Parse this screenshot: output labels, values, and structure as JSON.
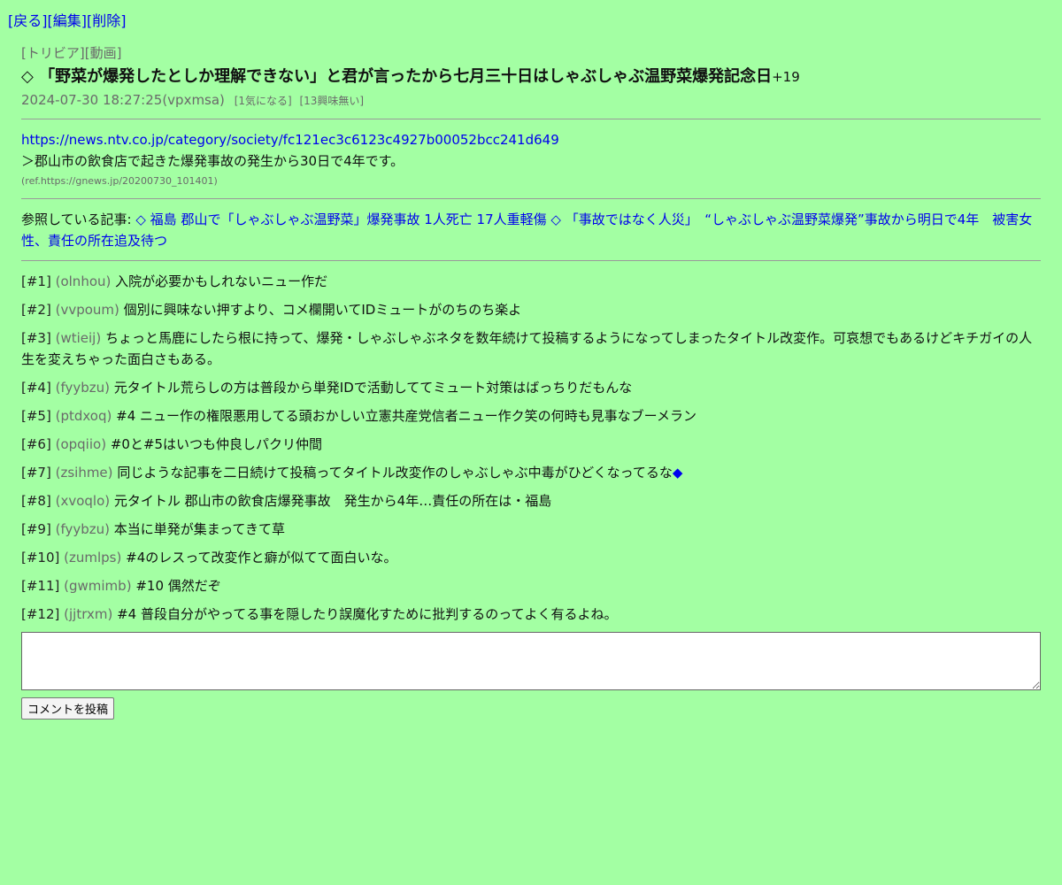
{
  "nav": {
    "back": "[戻る]",
    "edit": "[編集]",
    "delete": "[削除]"
  },
  "article": {
    "cat1": "[トリビア]",
    "cat2": "[動画]",
    "title": "◇ 「野菜が爆発したとしか理解できない」と君が言ったから七月三十日はしゃぶしゃぶ温野菜爆発記念日",
    "score": "+19",
    "date": "2024-07-30 18:27:25",
    "author": "(vpxmsa)",
    "interested": "[1気になる]",
    "not_interested": "[13興味無い]",
    "url": "https://news.ntv.co.jp/category/society/fc121ec3c6123c4927b00052bcc241d649",
    "quote": "＞郡山市の飲食店で起きた爆発事故の発生から30日で4年です。",
    "ref": "(ref.https://gnews.jp/20200730_101401)",
    "related_label": "参照している記事: ",
    "related_link1": "◇ 福島 郡山で「しゃぶしゃぶ温野菜」爆発事故 1人死亡 17人重軽傷",
    "related_link2": "◇ 「事故ではなく人災」　“しゃぶしゃぶ温野菜爆発”事故から明日で4年　被害女性、責任の所在追及待つ"
  },
  "comments": [
    {
      "num": "[#1]",
      "uid": "(olnhou)",
      "text": "入院が必要かもしれないニュー作だ"
    },
    {
      "num": "[#2]",
      "uid": "(vvpoum)",
      "text": "個別に興味ない押すより、コメ欄開いてIDミュートがのちのち楽よ"
    },
    {
      "num": "[#3]",
      "uid": "(wtieij)",
      "text": "ちょっと馬鹿にしたら根に持って、爆発・しゃぶしゃぶネタを数年続けて投稿するようになってしまったタイトル改変作。可哀想でもあるけどキチガイの人生を変えちゃった面白さもある。"
    },
    {
      "num": "[#4]",
      "uid": "(fyybzu)",
      "text": "元タイトル荒らしの方は普段から単発IDで活動しててミュート対策はばっちりだもんな"
    },
    {
      "num": "[#5]",
      "uid": "(ptdxoq)",
      "text": "#4 ニュー作の権限悪用してる頭おかしい立憲共産党信者ニュー作ク笑の何時も見事なブーメラン"
    },
    {
      "num": "[#6]",
      "uid": "(opqiio)",
      "text": "#0と#5はいつも仲良しパクリ仲間"
    },
    {
      "num": "[#7]",
      "uid": "(zsihme)",
      "text": "同じような記事を二日続けて投稿ってタイトル改変作のしゃぶしゃぶ中毒がひどくなってるな",
      "link": "◆"
    },
    {
      "num": "[#8]",
      "uid": "(xvoqlo)",
      "text": "元タイトル 郡山市の飲食店爆発事故　発生から4年…責任の所在は・福島"
    },
    {
      "num": "[#9]",
      "uid": "(fyybzu)",
      "text": "本当に単発が集まってきて草"
    },
    {
      "num": "[#10]",
      "uid": "(zumlps)",
      "text": "#4のレスって改変作と癖が似てて面白いな。"
    },
    {
      "num": "[#11]",
      "uid": "(gwmimb)",
      "text": "#10 偶然だぞ"
    },
    {
      "num": "[#12]",
      "uid": "(jjtrxm)",
      "text": "#4 普段自分がやってる事を隠したり誤魔化すために批判するのってよく有るよね。"
    }
  ],
  "form": {
    "textarea_value": "",
    "submit_label": "コメントを投稿"
  }
}
